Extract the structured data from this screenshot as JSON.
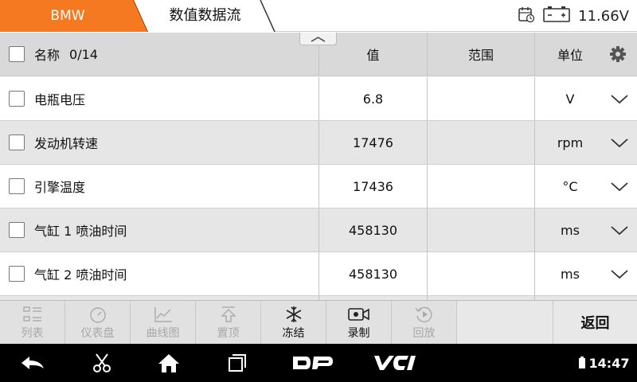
{
  "header": {
    "brand": "BMW",
    "title": "数值数据流",
    "voltage": "11.66V",
    "brand_color": "#f47920"
  },
  "table": {
    "columns": {
      "name": "名称",
      "count": "0/14",
      "value": "值",
      "range": "范围",
      "unit": "单位"
    },
    "rows": [
      {
        "name": "电瓶电压",
        "value": "6.8",
        "range": "",
        "unit": "V"
      },
      {
        "name": "发动机转速",
        "value": "17476",
        "range": "",
        "unit": "rpm"
      },
      {
        "name": "引擎温度",
        "value": "17436",
        "range": "",
        "unit": "°C"
      },
      {
        "name": "气缸 1 喷油时间",
        "value": "458130",
        "range": "",
        "unit": "ms"
      },
      {
        "name": "气缸 2 喷油时间",
        "value": "458130",
        "range": "",
        "unit": "ms"
      }
    ]
  },
  "toolbar": {
    "list": "列表",
    "dashboard": "仪表盘",
    "graph": "曲线图",
    "pin_top": "置顶",
    "freeze": "冻结",
    "record": "录制",
    "playback": "回放",
    "back": "返回"
  },
  "status": {
    "time": "14:47",
    "dp_logo": "DP",
    "vci_logo": "VCI"
  }
}
